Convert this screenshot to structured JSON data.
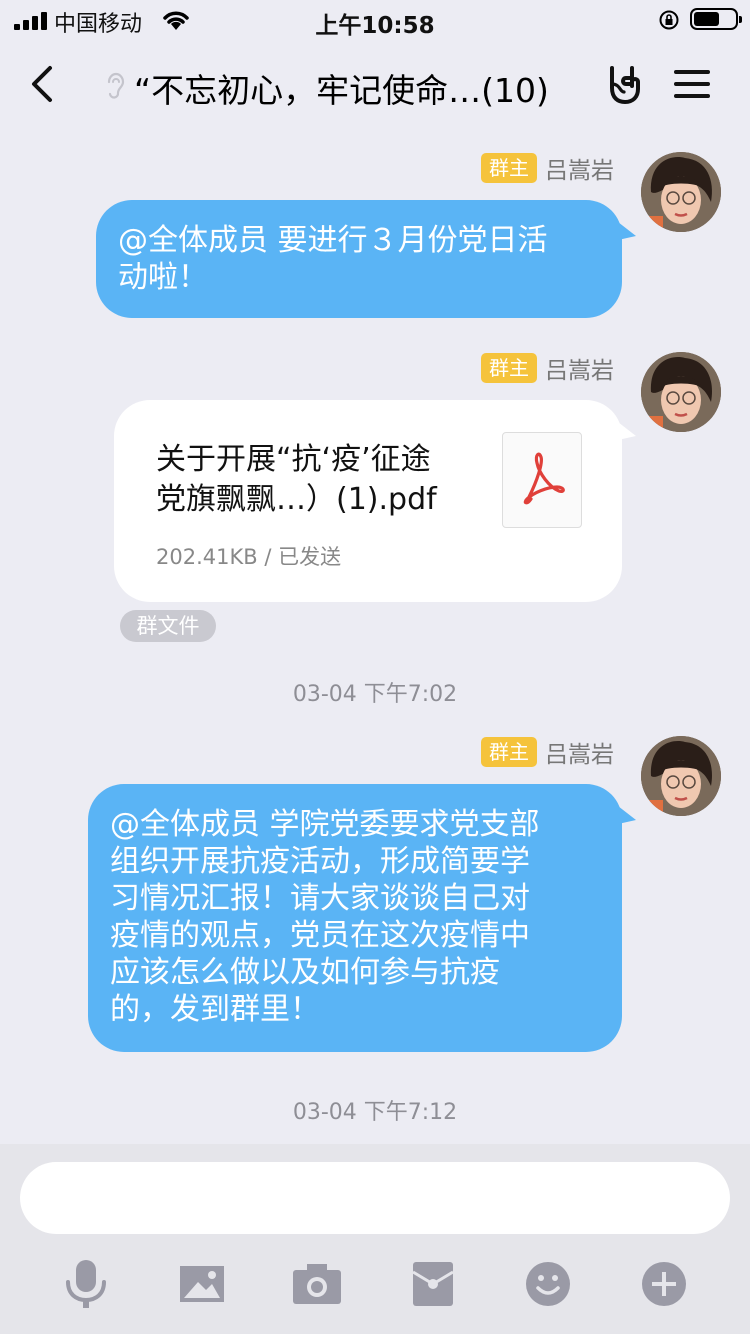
{
  "status_bar": {
    "carrier": "中国移动",
    "time": "上午10:58"
  },
  "nav": {
    "title": "“不忘初心，牢记使命…(10)"
  },
  "messages": [
    {
      "sender_role": "群主",
      "sender_name": "吕嵩岩",
      "text_lines": [
        "@全体成员 要进行３月份党日活",
        "动啦！"
      ]
    },
    {
      "sender_role": "群主",
      "sender_name": "吕嵩岩",
      "file": {
        "name_lines": [
          "关于开展“抗‘疫’征途",
          "党旗飘飘…）(1).pdf"
        ],
        "meta": "202.41KB / 已发送",
        "tag": "群文件"
      }
    },
    {
      "sender_role": "群主",
      "sender_name": "吕嵩岩",
      "text_lines": [
        "@全体成员 学院党委要求党支部",
        "组织开展抗疫活动，形成简要学",
        "习情况汇报！请大家谈谈自己对",
        "疫情的观点，党员在这次疫情中",
        "应该怎么做以及如何参与抗疫",
        "的，发到群里！"
      ]
    }
  ],
  "timestamps": [
    "03-04 下午7:02",
    "03-04 下午7:12"
  ],
  "input": {
    "placeholder": ""
  },
  "toolbar_icons": [
    "microphone-icon",
    "image-icon",
    "camera-icon",
    "red-packet-icon",
    "emoji-icon",
    "plus-icon"
  ],
  "colors": {
    "background": "#ececf3",
    "bubble": "#5ab4f5",
    "badge": "#f5c33b",
    "pdf_red": "#e0403a",
    "tool_gray": "#9a9aa6"
  }
}
